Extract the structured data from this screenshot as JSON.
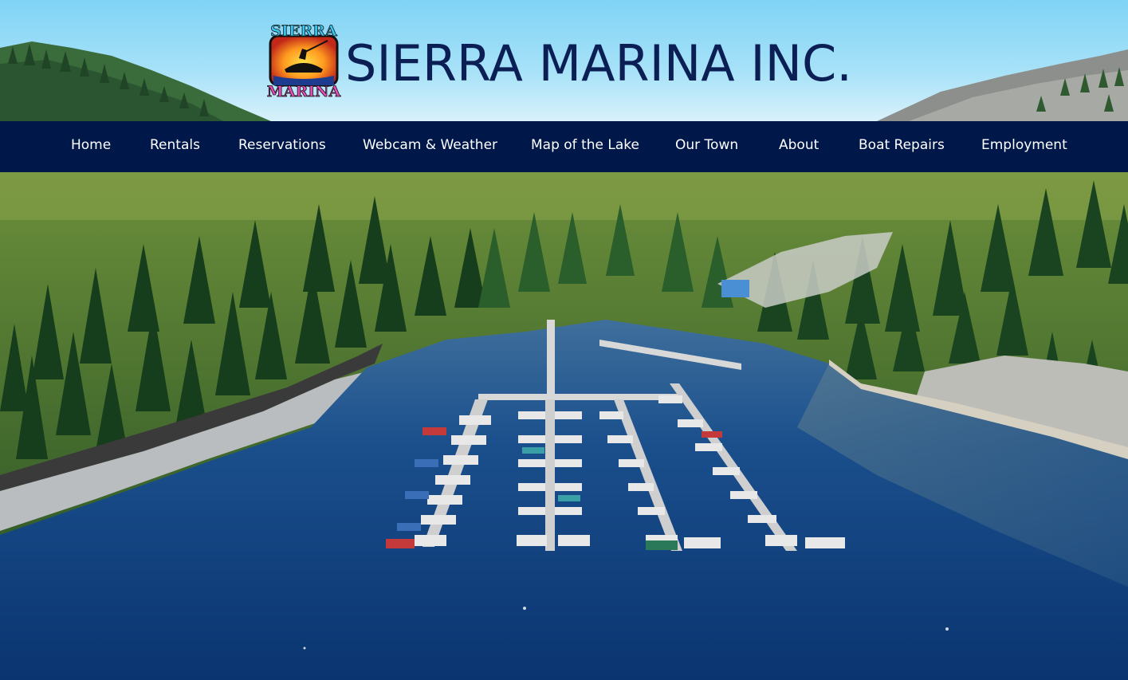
{
  "site": {
    "title": "SIERRA MARINA INC.",
    "logo_text_top": "SIERRA",
    "logo_text_bottom": "MARINA",
    "logo_icon": "fisherman-sunset-logo"
  },
  "nav": {
    "items": [
      {
        "label": "Home"
      },
      {
        "label": "Rentals"
      },
      {
        "label": "Reservations"
      },
      {
        "label": "Webcam & Weather"
      },
      {
        "label": "Map of the Lake"
      },
      {
        "label": "Our Town"
      },
      {
        "label": "About"
      },
      {
        "label": "Boat Repairs"
      },
      {
        "label": "Employment"
      }
    ]
  },
  "colors": {
    "nav_background": "#00174a",
    "title_color": "#0b1f55",
    "sky": "#7fd3f5",
    "lake": "#0a3f86"
  },
  "hero": {
    "image": "aerial-marina-lake-photo"
  }
}
